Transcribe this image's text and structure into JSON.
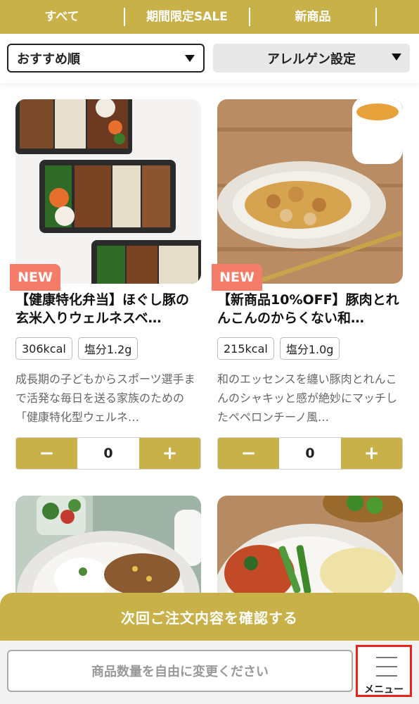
{
  "nav": {
    "tabs": [
      "すべて",
      "期間限定SALE",
      "新商品"
    ]
  },
  "filters": {
    "sort_label": "おすすめ順",
    "allergen_label": "アレルゲン設定"
  },
  "products": [
    {
      "badge": "NEW",
      "title": "【健康特化弁当】ほぐし豚の玄米入りウェルネスベ…",
      "tags": [
        "306kcal",
        "塩分1.2g"
      ],
      "description": "成長期の子どもからスポーツ選手まで活発な毎日を送る家族のための「健康特化型ウェルネ…",
      "quantity": "0",
      "minus": "−",
      "plus": "+"
    },
    {
      "badge": "NEW",
      "title": "【新商品10%OFF】豚肉とれんこんのからくない和…",
      "tags": [
        "215kcal",
        "塩分1.0g"
      ],
      "description": "和のエッセンスを纏い豚肉とれんこんのシャキッと感が絶妙にマッチしたペペロンチーノ風…",
      "quantity": "0",
      "minus": "−",
      "plus": "+"
    }
  ],
  "footer": {
    "confirm_label": "次回ご注文内容を確認する",
    "hint_label": "商品数量を自由に変更ください",
    "menu_label": "メニュー"
  },
  "colors": {
    "accent": "#c9b14a",
    "badge": "#f47c69",
    "highlight": "#e8231b"
  }
}
